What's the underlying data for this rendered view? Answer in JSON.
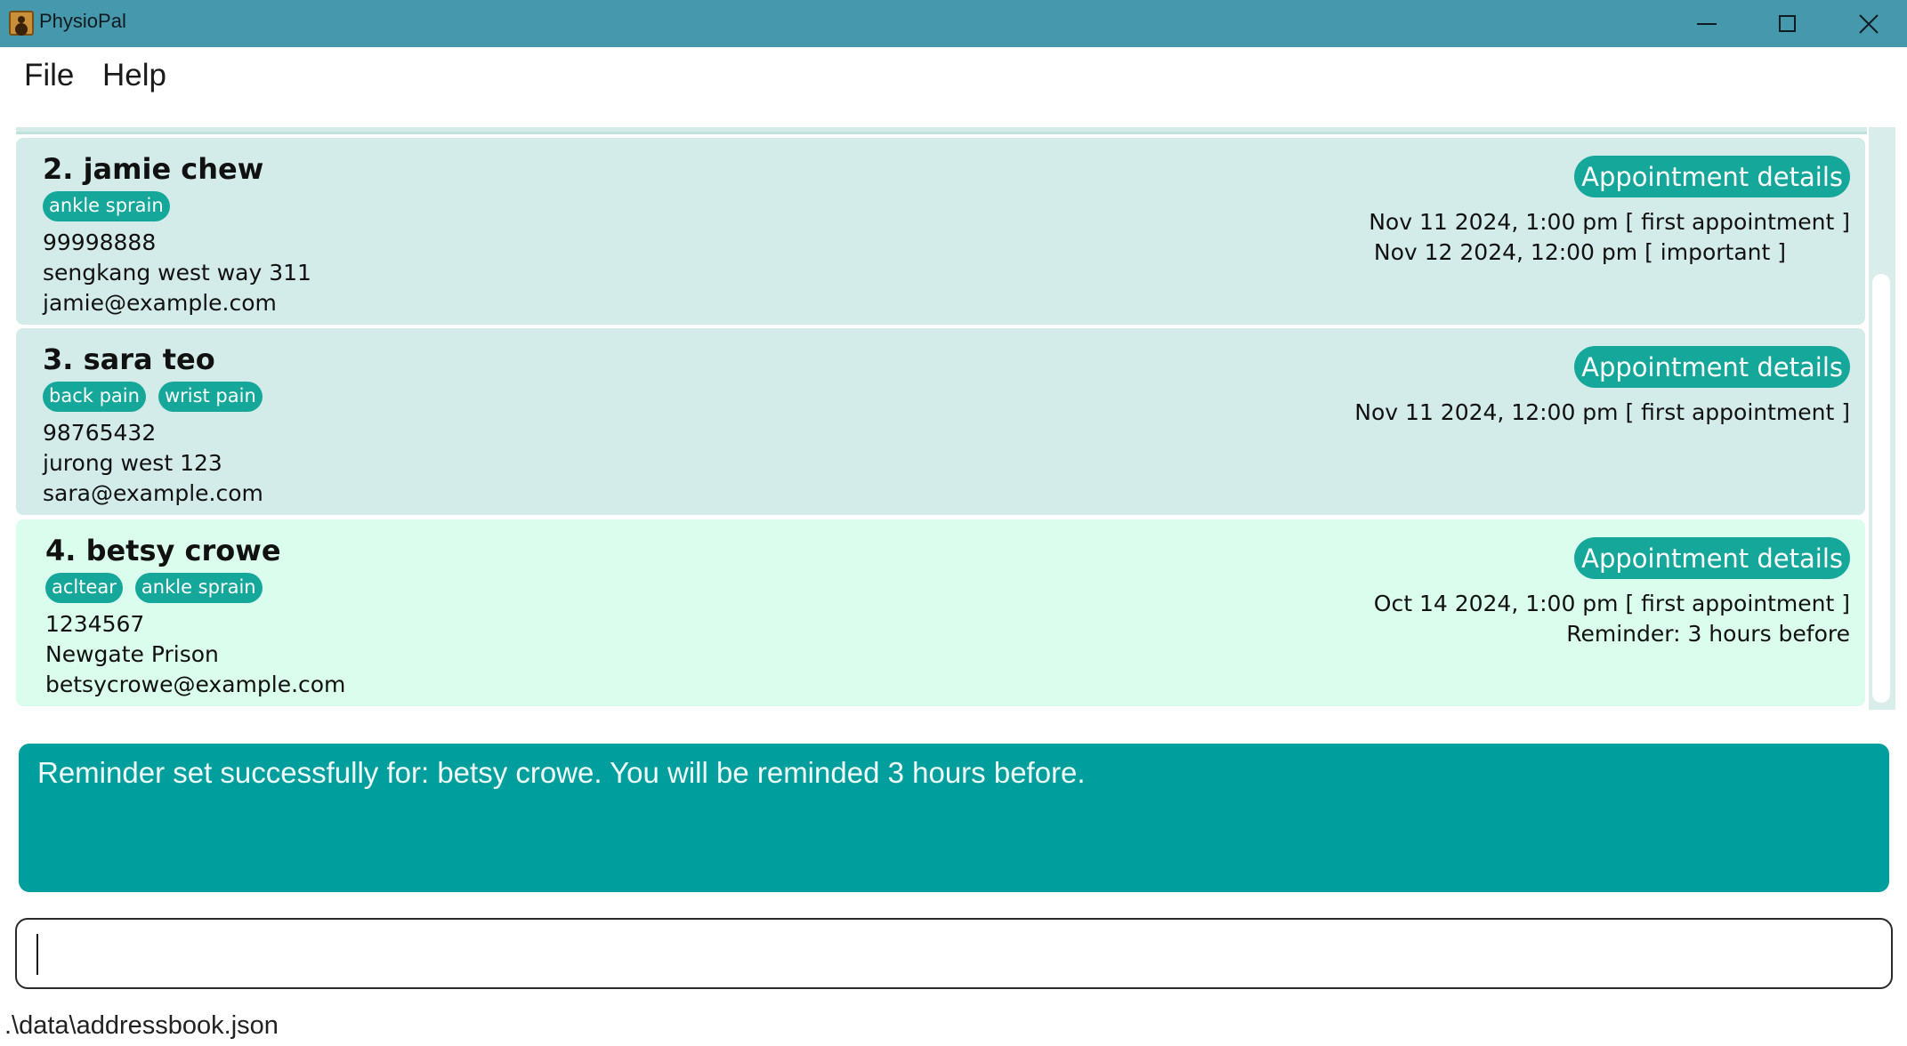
{
  "window": {
    "title": "PhysioPal",
    "controls": {
      "minimize": "minimize-icon",
      "maximize": "maximize-icon",
      "close": "close-icon"
    }
  },
  "menu": {
    "file": "File",
    "help": "Help"
  },
  "colors": {
    "titlebar": "#4699ad",
    "accent": "#16a79b",
    "card": "#d3ece9",
    "selected_card": "#dbfdee",
    "result_bg": "#009e9c"
  },
  "patients": [
    {
      "title": "2. jamie chew",
      "tags": [
        "ankle sprain"
      ],
      "phone": "99998888",
      "address": "sengkang west way 311",
      "email": "jamie@example.com",
      "button": "Appointment details",
      "details": [
        "Nov 11 2024, 1:00 pm [ first appointment ]",
        "Nov 12 2024, 12:00 pm [ important ]"
      ]
    },
    {
      "title": "3. sara teo",
      "tags": [
        "back pain",
        "wrist pain"
      ],
      "phone": "98765432",
      "address": "jurong west 123",
      "email": "sara@example.com",
      "button": "Appointment details",
      "details": [
        "Nov 11 2024, 12:00 pm [ first appointment ]"
      ]
    },
    {
      "title": "4. betsy crowe",
      "tags": [
        "acltear",
        "ankle sprain"
      ],
      "phone": "1234567",
      "address": "Newgate Prison",
      "email": "betsycrowe@example.com",
      "button": "Appointment details",
      "details": [
        "Oct 14 2024, 1:00 pm [ first appointment ]",
        "Reminder: 3 hours before"
      ]
    }
  ],
  "result": {
    "message": "Reminder set successfully for: betsy crowe. You will be reminded 3 hours before."
  },
  "command": {
    "value": ""
  },
  "status": {
    "path": ".\\data\\addressbook.json"
  }
}
